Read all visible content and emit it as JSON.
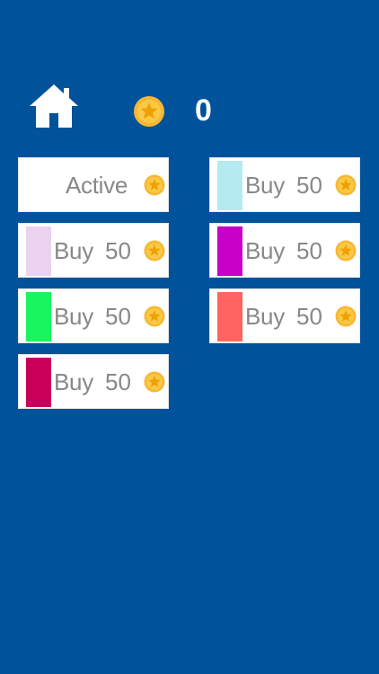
{
  "header": {
    "home_icon": "home-icon",
    "coin_icon": "coin-star-icon",
    "coin_count": "0"
  },
  "colors": {
    "background": "#00529b",
    "coin_fill": "#f7b733",
    "coin_star": "#f0a000"
  },
  "shop": {
    "items": [
      {
        "state": "Active",
        "swatch": null
      },
      {
        "label": "Buy",
        "price": "50",
        "swatch": "#b4eaf0"
      },
      {
        "label": "Buy",
        "price": "50",
        "swatch": "#ead3ee"
      },
      {
        "label": "Buy",
        "price": "50",
        "swatch": "#c800c8"
      },
      {
        "label": "Buy",
        "price": "50",
        "swatch": "#19f55e"
      },
      {
        "label": "Buy",
        "price": "50",
        "swatch": "#ff6460"
      },
      {
        "label": "Buy",
        "price": "50",
        "swatch": "#c8005a"
      }
    ]
  }
}
